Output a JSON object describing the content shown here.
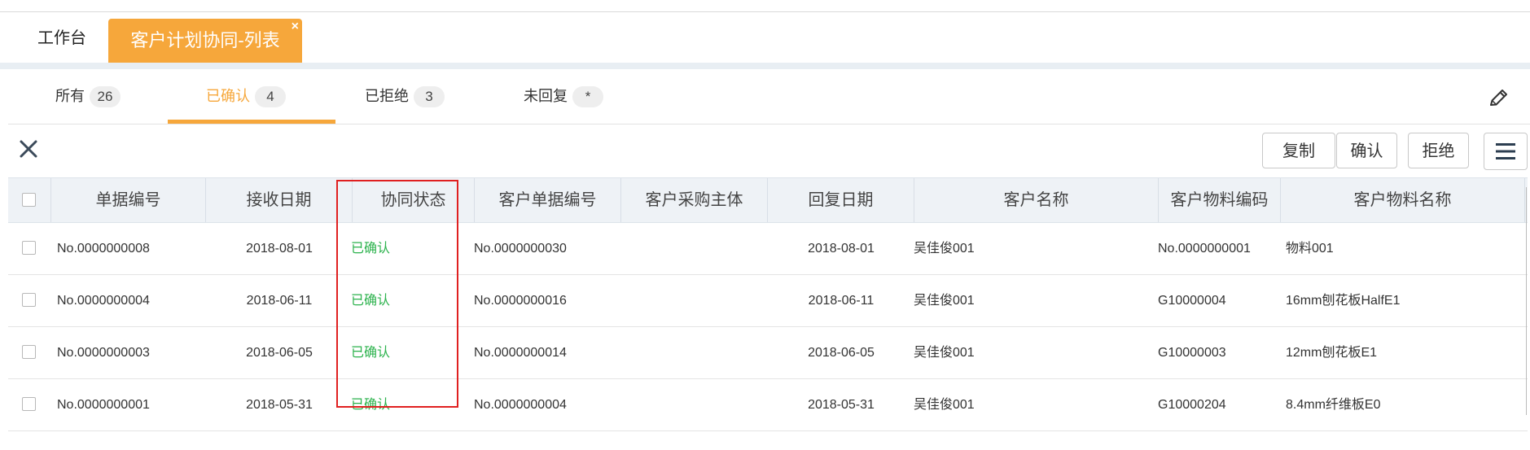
{
  "tabs": {
    "workbench": "工作台",
    "active": "客户计划协同-列表",
    "close_glyph": "×"
  },
  "filters": [
    {
      "label": "所有",
      "count": "26"
    },
    {
      "label": "已确认",
      "count": "4"
    },
    {
      "label": "已拒绝",
      "count": "3"
    },
    {
      "label": "未回复",
      "count": "*"
    }
  ],
  "toolbar": {
    "copy_label": "复制",
    "confirm_label": "确认",
    "reject_label": "拒绝"
  },
  "table": {
    "columns": [
      "单据编号",
      "接收日期",
      "协同状态",
      "客户单据编号",
      "客户采购主体",
      "回复日期",
      "客户名称",
      "客户物料编码",
      "客户物料名称"
    ],
    "rows": [
      [
        "No.0000000008",
        "2018-08-01",
        "已确认",
        "No.0000000030",
        "",
        "2018-08-01",
        "吴佳俊001",
        "No.0000000001",
        "物料001"
      ],
      [
        "No.0000000004",
        "2018-06-11",
        "已确认",
        "No.0000000016",
        "",
        "2018-06-11",
        "吴佳俊001",
        "G10000004",
        "16mm刨花板HalfE1"
      ],
      [
        "No.0000000003",
        "2018-06-05",
        "已确认",
        "No.0000000014",
        "",
        "2018-06-05",
        "吴佳俊001",
        "G10000003",
        "12mm刨花板E1"
      ],
      [
        "No.0000000001",
        "2018-05-31",
        "已确认",
        "No.0000000004",
        "",
        "2018-05-31",
        "吴佳俊001",
        "G10000204",
        "8.4mm纤维板E0"
      ]
    ]
  },
  "colors": {
    "accent": "#f6a73b",
    "status_green": "#2bb24c",
    "highlight_red": "#e02020"
  },
  "icons": [
    "close-tab-icon",
    "edit-pencil-icon",
    "close-x-icon",
    "hamburger-menu-icon"
  ]
}
